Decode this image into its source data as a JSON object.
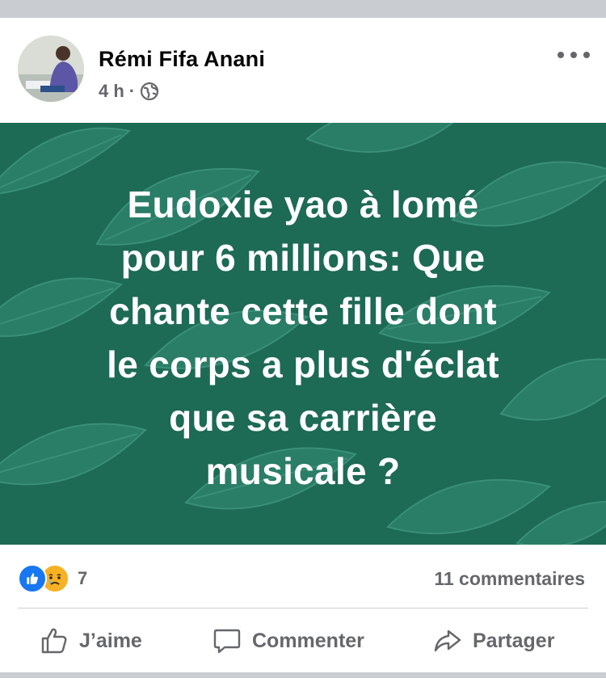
{
  "post": {
    "author": "Rémi Fifa Anani",
    "time": "4 h",
    "separator": "·",
    "text_lines": [
      "Eudoxie yao à lomé",
      "pour 6 millions: Que",
      "chante cette fille dont",
      "le corps a plus d'éclat",
      "que sa carrière",
      "musicale ?"
    ],
    "background_color": "#1d6a55",
    "privacy_icon": "globe-icon"
  },
  "engagement": {
    "reaction_icons": [
      "like-reaction-icon",
      "sad-reaction-icon"
    ],
    "reaction_count": "7",
    "comments": "11 commentaires"
  },
  "actions": {
    "like": "J’aime",
    "comment": "Commenter",
    "share": "Partager"
  },
  "colors": {
    "like_blue": "#1877f2",
    "sad_yellow": "#f7b125",
    "muted_text": "#65676b"
  }
}
